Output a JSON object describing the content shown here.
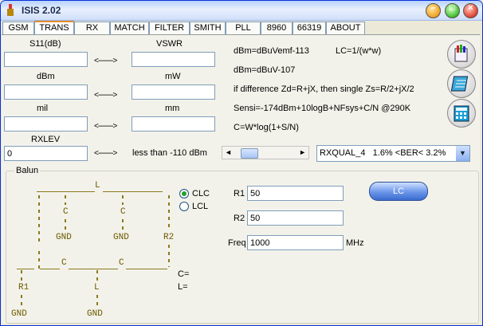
{
  "window": {
    "title": "ISIS 2.02"
  },
  "tabs": [
    "GSM",
    "TRANS",
    "RX",
    "MATCH",
    "FILTER",
    "SMITH",
    "PLL",
    "8960",
    "66319",
    "ABOUT"
  ],
  "active_tab": "TRANS",
  "converters": {
    "s11_label": "S11(dB)",
    "vswr_label": "VSWR",
    "dbm_label": "dBm",
    "mw_label": "mW",
    "mil_label": "mil",
    "mm_label": "mm",
    "rxlev_label": "RXLEV",
    "rxlev_value": "0",
    "arrow": "<-------->",
    "rxlev_result": "less than -110 dBm"
  },
  "formulas": {
    "f1": "dBm=dBuVemf-113",
    "f1b": "LC=1/(w*w)",
    "f2": "dBm=dBuV-107",
    "f3": "if difference Zd=R+jX, then single Zs=R/2+jX/2",
    "f4": "Sensi=-174dBm+10logB+NFsys+C/N  @290K",
    "f5": "C=W*log(1+S/N)"
  },
  "rxqual": {
    "selected": "RXQUAL_4   1.6% <BER< 3.2%",
    "slider_position": 0.12
  },
  "balun": {
    "title": "Balun",
    "options": {
      "clc": "CLC",
      "lcl": "LCL",
      "selected": "CLC"
    },
    "r1_label": "R1",
    "r1_value": "50",
    "r2_label": "R2",
    "r2_value": "50",
    "freq_label": "Freq",
    "freq_value": "1000",
    "freq_unit": "MHz",
    "lc_button": "LC",
    "c_out": "C=",
    "l_out": "L=",
    "circuit": {
      "L": "L",
      "C": "C",
      "GND": "GND",
      "R2": "R2",
      "R1": "R1"
    }
  },
  "icons": [
    "calculator-icon",
    "notebook-icon",
    "keypad-icon"
  ],
  "colors": {
    "accent": "#e68b2c",
    "titlebar": "#b7d2fb",
    "circuit": "#8a7a20"
  }
}
